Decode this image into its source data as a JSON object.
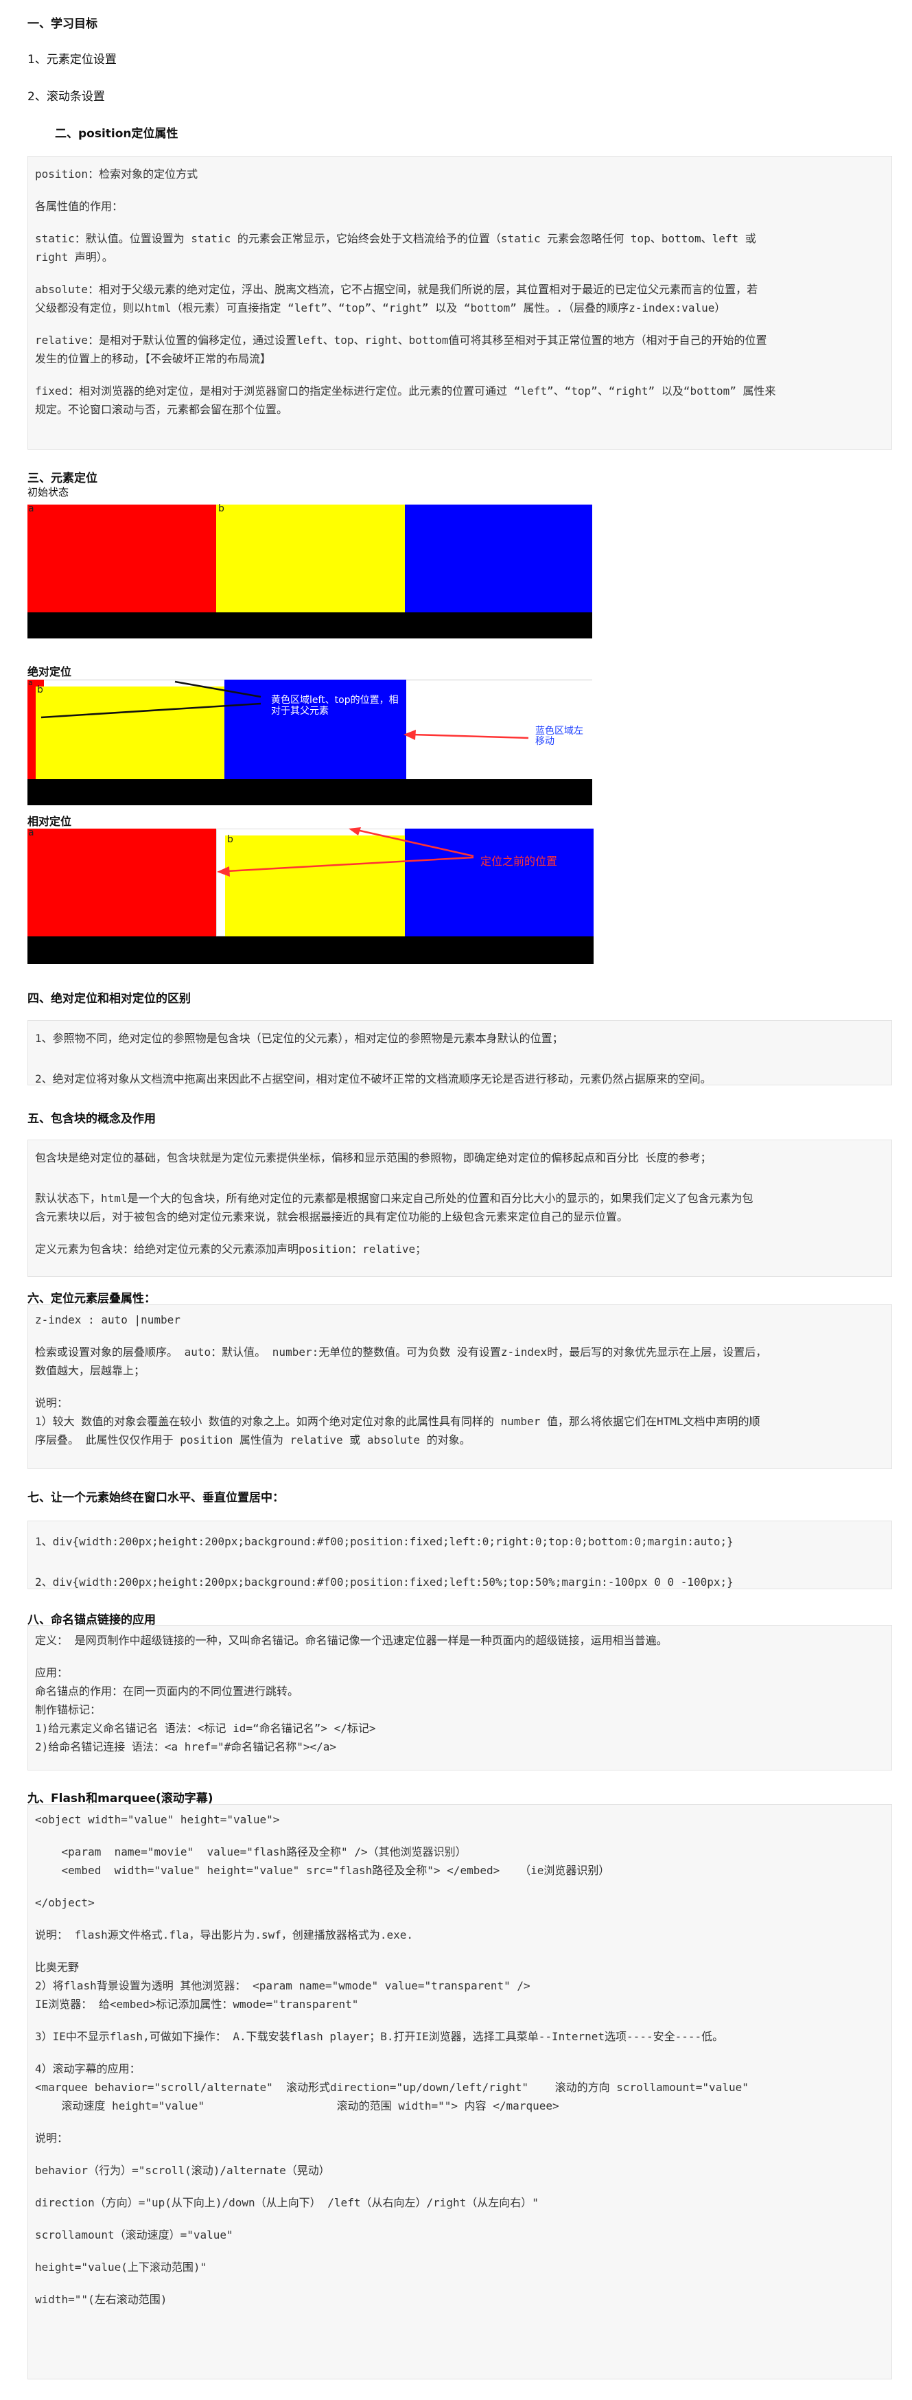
{
  "section1": {
    "title": "一、学习目标",
    "items": [
      "1、元素定位设置",
      "2、滚动条设置"
    ]
  },
  "section2": {
    "title": "二、position定位属性",
    "lines": [
      "position：检索对象的定位方式",
      "",
      "各属性值的作用：",
      "",
      "static：默认值。位置设置为 static 的元素会正常显示，它始终会处于文档流给予的位置（static 元素会忽略任何 top、bottom、left 或",
      "right 声明）。",
      "",
      "absolute：相对于父级元素的绝对定位，浮出、脱离文档流，它不占据空间，就是我们所说的层，其位置相对于最近的已定位父元素而言的位置，若",
      "父级都没有定位，则以html（根元素）可直接指定 “left”、“top”、“right” 以及 “bottom” 属性。.（层叠的顺序z-index:value）",
      "",
      "relative：是相对于默认位置的偏移定位，通过设置left、top、right、bottom值可将其移至相对于其正常位置的地方（相对于自己的开始的位置",
      "发生的位置上的移动，【不会破坏正常的布局流】",
      "",
      "fixed：相对浏览器的绝对定位，是相对于浏览器窗口的指定坐标进行定位。此元素的位置可通过 “left”、“top”、“right” 以及“bottom” 属性来",
      "规定。不论窗口滚动与否，元素都会留在那个位置。"
    ]
  },
  "section3": {
    "title": "三、元素定位",
    "initial_label": "初始状态",
    "absolute_label": "绝对定位",
    "relative_label": "相对定位",
    "box_labels": {
      "a": "a",
      "b": "b"
    },
    "annotation_absolute_yellow": "黄色区域left、top的位置，相对于其父元素",
    "annotation_absolute_blue": "蓝色区域左移动",
    "annotation_relative": "定位之前的位置",
    "colors": {
      "red": "#ff0000",
      "yellow": "#ffff00",
      "blue": "#0000ff",
      "black": "#000000",
      "arrow": "#ff3333"
    }
  },
  "section4": {
    "title": "四、绝对定位和相对定位的区别",
    "lines": [
      "1、参照物不同，绝对定位的参照物是包含块（已定位的父元素），相对定位的参照物是元素本身默认的位置；",
      "",
      "2、绝对定位将对象从文档流中拖离出来因此不占据空间，相对定位不破坏正常的文档流顺序无论是否进行移动，元素仍然占据原来的空间。"
    ]
  },
  "section5": {
    "title": "五、包含块的概念及作用",
    "lines": [
      "包含块是绝对定位的基础，包含块就是为定位元素提供坐标，偏移和显示范围的参照物，即确定绝对定位的偏移起点和百分比 长度的参考；",
      "",
      "默认状态下，html是一个大的包含块，所有绝对定位的元素都是根据窗口来定自己所处的位置和百分比大小的显示的，如果我们定义了包含元素为包",
      "含元素块以后，对于被包含的绝对定位元素来说，就会根据最接近的具有定位功能的上级包含元素来定位自己的显示位置。",
      "",
      "定义元素为包含块：给绝对定位元素的父元素添加声明position：relative；"
    ]
  },
  "section6": {
    "title": "六、定位元素层叠属性：",
    "lines": [
      "z-index : auto |number",
      "",
      "检索或设置对象的层叠顺序。 auto：默认值。 number:无单位的整数值。可为负数 没有设置z-index时，最后写的对象优先显示在上层，设置后，",
      "数值越大，层越靠上；",
      "",
      "说明：",
      "1）较大 数值的对象会覆盖在较小 数值的对象之上。如两个绝对定位对象的此属性具有同样的 number 值，那么将依据它们在HTML文档中声明的顺",
      "序层叠。 此属性仅仅作用于 position 属性值为 relative 或 absolute 的对象。"
    ]
  },
  "section7": {
    "title": "七、让一个元素始终在窗口水平、垂直位置居中：",
    "lines": [
      "1、div{width:200px;height:200px;background:#f00;position:fixed;left:0;right:0;top:0;bottom:0;margin:auto;}",
      "",
      "2、div{width:200px;height:200px;background:#f00;position:fixed;left:50%;top:50%;margin:-100px 0 0 -100px;}"
    ]
  },
  "section8": {
    "title": "八、命名锚点链接的应用",
    "lines": [
      "定义： 是网页制作中超级链接的一种，又叫命名锚记。命名锚记像一个迅速定位器一样是一种页面内的超级链接，运用相当普遍。",
      "",
      "应用：",
      "命名锚点的作用：在同一页面内的不同位置进行跳转。",
      "制作锚标记：",
      "1)给元素定义命名锚记名 语法：<标记 id=“命名锚记名”> </标记>",
      "2)给命名锚记连接 语法：<a href=\"#命名锚记名称\"></a>"
    ]
  },
  "section9": {
    "title": "九、Flash和marquee(滚动字幕)",
    "lines": [
      "<object width=\"value\" height=\"value\">",
      "",
      "    <param  name=\"movie\"  value=\"flash路径及全称\" />（其他浏览器识别）",
      "    <embed  width=\"value\" height=\"value\" src=\"flash路径及全称\"> </embed>   （ie浏览器识别）",
      "",
      "</object>",
      "",
      "说明： flash源文件格式.fla，导出影片为.swf，创建播放器格式为.exe.",
      "",
      "比奥无野",
      "2）将flash背景设置为透明 其他浏览器： <param name=\"wmode\" value=\"transparent\" />",
      "IE浏览器： 给<embed>标记添加属性：wmode=\"transparent\"",
      "",
      "3）IE中不显示flash,可做如下操作： A.下载安装flash player；B.打开IE浏览器，选择工具菜单--Internet选项----安全----低。",
      "",
      "4）滚动字幕的应用：",
      "<marquee behavior=\"scroll/alternate\"  滚动形式direction=\"up/down/left/right\"    滚动的方向 scrollamount=\"value\"",
      "    滚动速度 height=\"value\"                    滚动的范围 width=\"\"> 内容 </marquee>",
      "",
      "说明：",
      "",
      "behavior（行为）=\"scroll(滚动)/alternate（晃动）",
      "",
      "direction（方向）=\"up(从下向上)/down（从上向下） /left（从右向左）/right（从左向右）\"",
      "",
      "scrollamount（滚动速度）=\"value\"",
      "",
      "height=\"value(上下滚动范围)\"",
      "",
      "width=\"\"(左右滚动范围)"
    ]
  }
}
